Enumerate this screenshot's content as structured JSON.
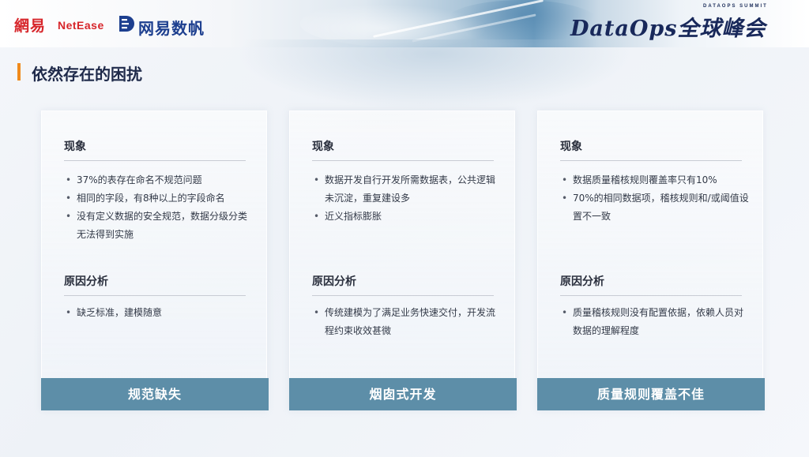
{
  "header": {
    "brand_wy": "網易",
    "brand_netease": "NetEase",
    "brand_shufan": "网易数帆",
    "summit_small": "DATAOPS SUMMIT",
    "summit_title": "DataOps全球峰会"
  },
  "page": {
    "title": "依然存在的困扰",
    "accent_color": "#f08a1c",
    "footer_color": "#5d8ea8"
  },
  "cards": [
    {
      "phenomenon_title": "现象",
      "phenomenon": [
        "37%的表存在命名不规范问题",
        "相同的字段，有8种以上的字段命名",
        "没有定义数据的安全规范，数据分级分类无法得到实施"
      ],
      "cause_title": "原因分析",
      "cause": [
        "缺乏标准，建模随意"
      ],
      "footer": "规范缺失"
    },
    {
      "phenomenon_title": "现象",
      "phenomenon": [
        "数据开发自行开发所需数据表，公共逻辑未沉淀，重复建设多",
        "近义指标膨胀"
      ],
      "cause_title": "原因分析",
      "cause": [
        "传统建模为了满足业务快速交付，开发流程约束收效甚微"
      ],
      "footer": "烟囱式开发"
    },
    {
      "phenomenon_title": "现象",
      "phenomenon": [
        "数据质量稽核规则覆盖率只有10%",
        "70%的相同数据项，稽核规则和/或阈值设置不一致"
      ],
      "cause_title": "原因分析",
      "cause": [
        "质量稽核规则没有配置依据，依赖人员对数据的理解程度"
      ],
      "footer": "质量规则覆盖不佳"
    }
  ]
}
